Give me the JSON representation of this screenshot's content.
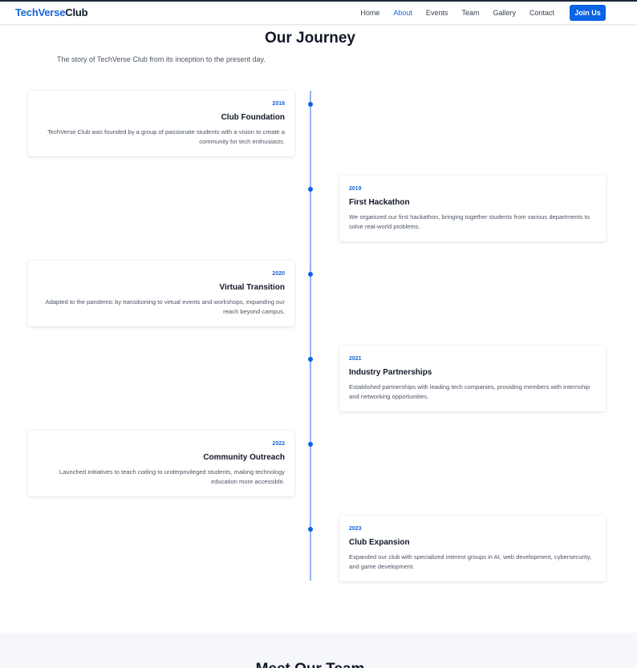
{
  "brand": {
    "part1": "TechVerse",
    "part2": "Club"
  },
  "nav": {
    "items": [
      {
        "label": "Home"
      },
      {
        "label": "About"
      },
      {
        "label": "Events"
      },
      {
        "label": "Team"
      },
      {
        "label": "Gallery"
      },
      {
        "label": "Contact"
      }
    ],
    "active": "About",
    "cta": "Join Us"
  },
  "journey": {
    "title": "Our Journey",
    "subtitle": "The story of TechVerse Club from its inception to the present day.",
    "events": [
      {
        "year": "2018",
        "title": "Club Foundation",
        "description": "TechVerse Club was founded by a group of passionate students with a vision to create a community for tech enthusiasts."
      },
      {
        "year": "2019",
        "title": "First Hackathon",
        "description": "We organized our first hackathon, bringing together students from various departments to solve real-world problems."
      },
      {
        "year": "2020",
        "title": "Virtual Transition",
        "description": "Adapted to the pandemic by transitioning to virtual events and workshops, expanding our reach beyond campus."
      },
      {
        "year": "2021",
        "title": "Industry Partnerships",
        "description": "Established partnerships with leading tech companies, providing members with internship and networking opportunities."
      },
      {
        "year": "2022",
        "title": "Community Outreach",
        "description": "Launched initiatives to teach coding to underprivileged students, making technology education more accessible."
      },
      {
        "year": "2023",
        "title": "Club Expansion",
        "description": "Expanded our club with specialized interest groups in AI, web development, cybersecurity, and game development."
      }
    ]
  },
  "next_section": {
    "title": "Meet Our Team"
  },
  "colors": {
    "accent": "#0b63e5",
    "timeline": "#93b4f5",
    "text": "#111827",
    "muted": "#4b5563"
  }
}
